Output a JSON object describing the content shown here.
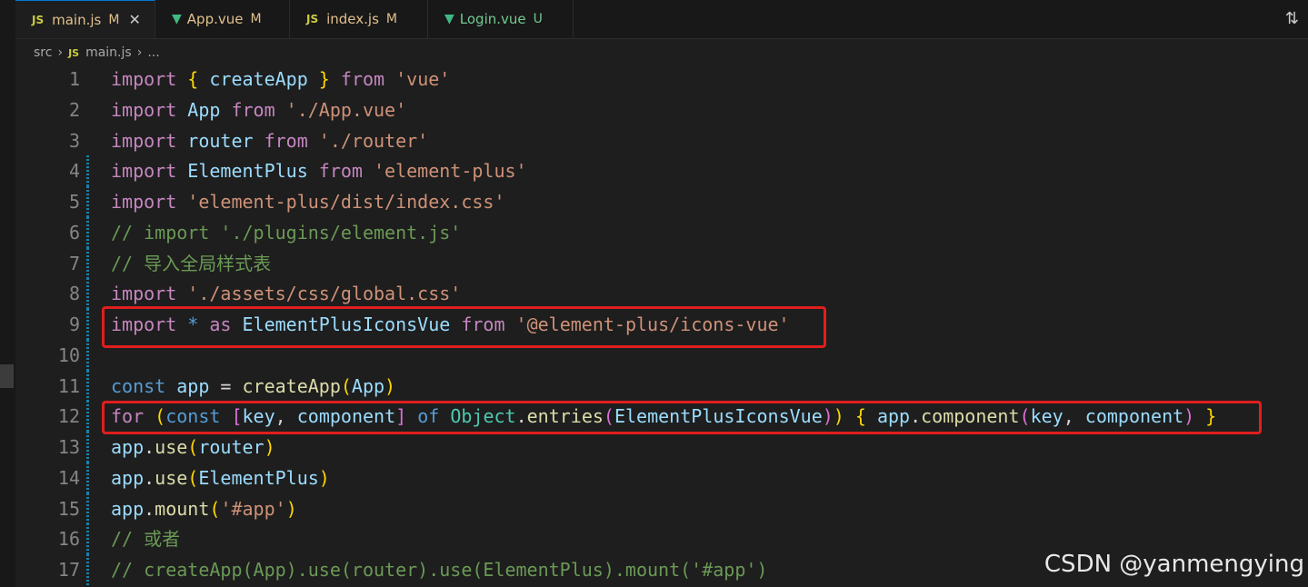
{
  "tabs": [
    {
      "icon": "JS",
      "name": "main.js",
      "status": "M",
      "active": true
    },
    {
      "icon": "vue",
      "name": "App.vue",
      "status": "M"
    },
    {
      "icon": "JS",
      "name": "index.js",
      "status": "M"
    },
    {
      "icon": "vue",
      "name": "Login.vue",
      "status": "U"
    }
  ],
  "breadcrumb": {
    "folder": "src",
    "file_icon": "JS",
    "file": "main.js",
    "more": "..."
  },
  "code_lines": [
    {
      "n": "1",
      "segments": [
        [
          "kw",
          "import "
        ],
        [
          "br1",
          "{ "
        ],
        [
          "id",
          "createApp"
        ],
        [
          "br1",
          " }"
        ],
        [
          "kw",
          " from "
        ],
        [
          "str",
          "'vue'"
        ]
      ]
    },
    {
      "n": "2",
      "segments": [
        [
          "kw",
          "import "
        ],
        [
          "id",
          "App"
        ],
        [
          "kw",
          " from "
        ],
        [
          "str",
          "'./App.vue'"
        ]
      ]
    },
    {
      "n": "3",
      "segments": [
        [
          "kw",
          "import "
        ],
        [
          "id",
          "router"
        ],
        [
          "kw",
          " from "
        ],
        [
          "str",
          "'./router'"
        ]
      ]
    },
    {
      "n": "4",
      "segments": [
        [
          "kw",
          "import "
        ],
        [
          "id",
          "ElementPlus"
        ],
        [
          "kw",
          " from "
        ],
        [
          "str",
          "'element-plus'"
        ]
      ]
    },
    {
      "n": "5",
      "segments": [
        [
          "kw",
          "import "
        ],
        [
          "str",
          "'element-plus/dist/index.css'"
        ]
      ]
    },
    {
      "n": "6",
      "segments": [
        [
          "cm",
          "// import './plugins/element.js'"
        ]
      ]
    },
    {
      "n": "7",
      "segments": [
        [
          "cm",
          "// 导入全局样式表"
        ]
      ]
    },
    {
      "n": "8",
      "segments": [
        [
          "kw",
          "import "
        ],
        [
          "str",
          "'./assets/css/global.css'"
        ]
      ]
    },
    {
      "n": "9",
      "segments": [
        [
          "kw",
          "import "
        ],
        [
          "kwb",
          "*"
        ],
        [
          "kw",
          " as "
        ],
        [
          "id",
          "ElementPlusIconsVue"
        ],
        [
          "kw",
          " from "
        ],
        [
          "str",
          "'@element-plus/icons-vue'"
        ]
      ]
    },
    {
      "n": "10",
      "segments": []
    },
    {
      "n": "11",
      "segments": [
        [
          "kwb",
          "const "
        ],
        [
          "id",
          "app"
        ],
        [
          "pl",
          " = "
        ],
        [
          "fn",
          "createApp"
        ],
        [
          "br1",
          "("
        ],
        [
          "id",
          "App"
        ],
        [
          "br1",
          ")"
        ]
      ]
    },
    {
      "n": "12",
      "segments": [
        [
          "kw",
          "for "
        ],
        [
          "br1",
          "("
        ],
        [
          "kwb",
          "const "
        ],
        [
          "br2",
          "["
        ],
        [
          "id",
          "key"
        ],
        [
          "pl",
          ", "
        ],
        [
          "id",
          "component"
        ],
        [
          "br2",
          "]"
        ],
        [
          "kwb",
          " of "
        ],
        [
          "cls",
          "Object"
        ],
        [
          "pl",
          "."
        ],
        [
          "fn",
          "entries"
        ],
        [
          "br2",
          "("
        ],
        [
          "id",
          "ElementPlusIconsVue"
        ],
        [
          "br2",
          ")"
        ],
        [
          "br1",
          ")"
        ],
        [
          "br1",
          " { "
        ],
        [
          "id",
          "app"
        ],
        [
          "pl",
          "."
        ],
        [
          "fn",
          "component"
        ],
        [
          "br2",
          "("
        ],
        [
          "id",
          "key"
        ],
        [
          "pl",
          ", "
        ],
        [
          "id",
          "component"
        ],
        [
          "br2",
          ")"
        ],
        [
          "br1",
          " }"
        ]
      ]
    },
    {
      "n": "13",
      "segments": [
        [
          "id",
          "app"
        ],
        [
          "pl",
          "."
        ],
        [
          "fn",
          "use"
        ],
        [
          "br1",
          "("
        ],
        [
          "id",
          "router"
        ],
        [
          "br1",
          ")"
        ]
      ]
    },
    {
      "n": "14",
      "segments": [
        [
          "id",
          "app"
        ],
        [
          "pl",
          "."
        ],
        [
          "fn",
          "use"
        ],
        [
          "br1",
          "("
        ],
        [
          "id",
          "ElementPlus"
        ],
        [
          "br1",
          ")"
        ]
      ]
    },
    {
      "n": "15",
      "segments": [
        [
          "id",
          "app"
        ],
        [
          "pl",
          "."
        ],
        [
          "fn",
          "mount"
        ],
        [
          "br1",
          "("
        ],
        [
          "str",
          "'#app'"
        ],
        [
          "br1",
          ")"
        ]
      ]
    },
    {
      "n": "16",
      "segments": [
        [
          "cm",
          "// 或者"
        ]
      ]
    },
    {
      "n": "17",
      "segments": [
        [
          "cm",
          "// createApp(App).use(router).use(ElementPlus).mount('#app')"
        ]
      ]
    }
  ],
  "watermark": "CSDN @yanmengying"
}
